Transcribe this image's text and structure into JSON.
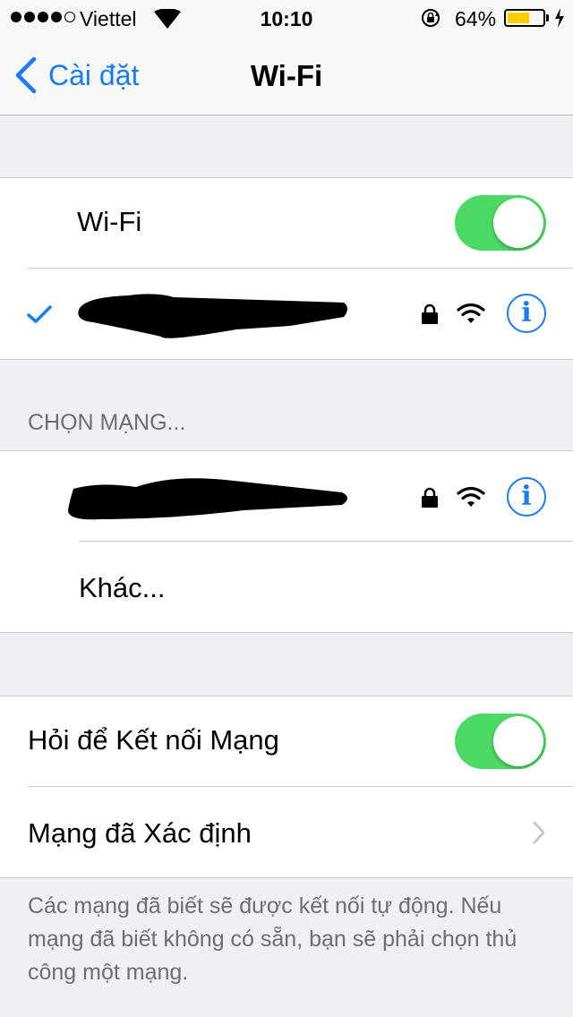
{
  "status_bar": {
    "signal_bars": 5,
    "signal_filled": 4,
    "carrier": "Viettel",
    "time": "10:10",
    "battery_percent_label": "64%",
    "battery_level": 0.64,
    "battery_color": "#ffcc00",
    "icons": [
      "signal-dots",
      "wifi-icon",
      "rotation-lock-icon",
      "battery-icon",
      "charging-bolt-icon"
    ]
  },
  "nav": {
    "back_label": "Cài đặt",
    "title": "Wi-Fi"
  },
  "wifi_group": {
    "wifi_label": "Wi-Fi",
    "wifi_on": true,
    "connected_network": {
      "name_redacted": true,
      "selected": true,
      "secured": true,
      "icons": [
        "checkmark-icon",
        "lock-icon",
        "wifi-signal-icon",
        "info-icon"
      ]
    }
  },
  "choose_network": {
    "header": "CHỌN MẠNG...",
    "networks": [
      {
        "name_redacted": true,
        "secured": true
      }
    ],
    "other_label": "Khác..."
  },
  "ask_group": {
    "ask_to_join_label": "Hỏi để Kết nối Mạng",
    "ask_to_join_on": true,
    "known_networks_label": "Mạng đã Xác định"
  },
  "footer": {
    "text": "Các mạng đã biết sẽ được kết nối tự động. Nếu mạng đã biết không có sẵn, bạn sẽ phải chọn thủ công một mạng."
  },
  "colors": {
    "accent": "#1a7cf3",
    "toggle_on": "#4cd964",
    "background": "#efeff4",
    "secondary_text": "#6d6d72"
  }
}
